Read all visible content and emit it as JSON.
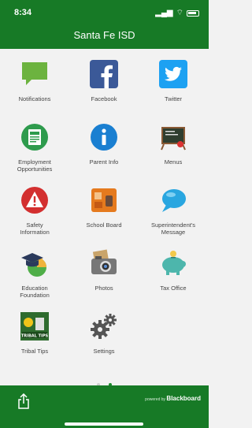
{
  "status": {
    "time": "8:34"
  },
  "header": {
    "title": "Santa Fe ISD"
  },
  "tiles": [
    {
      "label": "Notifications",
      "icon": "chat-bubble-icon",
      "color": "#6cb33f"
    },
    {
      "label": "Facebook",
      "icon": "facebook-icon",
      "color": "#3b5998"
    },
    {
      "label": "Twitter",
      "icon": "twitter-icon",
      "color": "#1da1f2"
    },
    {
      "label": "Employment\nOpportunities",
      "icon": "jobs-icon",
      "color": "#2e9b4d"
    },
    {
      "label": "Parent Info",
      "icon": "info-icon",
      "color": "#1a7fd1"
    },
    {
      "label": "Menus",
      "icon": "chalkboard-icon",
      "color": "#4a3726"
    },
    {
      "label": "Safety\nInformation",
      "icon": "warning-icon",
      "color": "#d32f2f"
    },
    {
      "label": "School Board",
      "icon": "school-board-icon",
      "color": "#e57a1e"
    },
    {
      "label": "Superintendent's\nMessage",
      "icon": "speech-bubble-icon",
      "color": "#29a6e0"
    },
    {
      "label": "Education\nFoundation",
      "icon": "graduation-cap-icon",
      "color": "#2b3a5c"
    },
    {
      "label": "Photos",
      "icon": "camera-icon",
      "color": "#555555"
    },
    {
      "label": "Tax Office",
      "icon": "piggy-bank-icon",
      "color": "#4db6ac"
    },
    {
      "label": "Tribal Tips",
      "icon": "tribal-tips-icon",
      "color": "#2e6b2e",
      "image_text": "TRIBAL TIPS"
    },
    {
      "label": "Settings",
      "icon": "gear-icon",
      "color": "#555555"
    }
  ],
  "pager": {
    "pages": 2,
    "active": 2
  },
  "footer": {
    "powered_by": "powered by",
    "brand": "Blackboard"
  }
}
